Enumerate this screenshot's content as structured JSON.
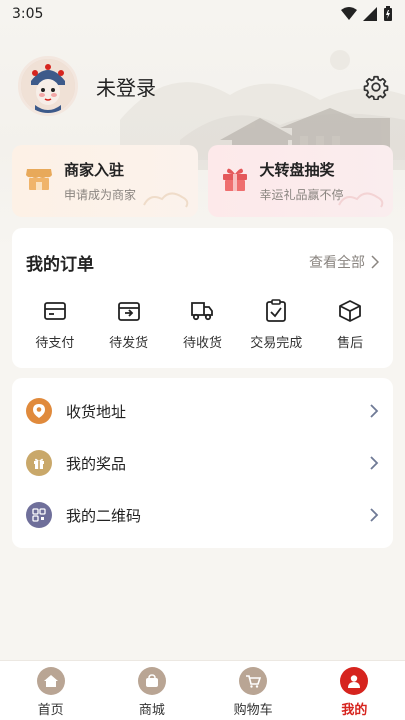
{
  "status": {
    "time": "3:05"
  },
  "profile": {
    "login_text": "未登录"
  },
  "promos": [
    {
      "title": "商家入驻",
      "subtitle": "申请成为商家"
    },
    {
      "title": "大转盘抽奖",
      "subtitle": "幸运礼品赢不停"
    }
  ],
  "orders": {
    "title": "我的订单",
    "view_all": "查看全部",
    "items": [
      {
        "label": "待支付"
      },
      {
        "label": "待发货"
      },
      {
        "label": "待收货"
      },
      {
        "label": "交易完成"
      },
      {
        "label": "售后"
      }
    ]
  },
  "menu": [
    {
      "label": "收货地址"
    },
    {
      "label": "我的奖品"
    },
    {
      "label": "我的二维码"
    }
  ],
  "tabs": [
    {
      "label": "首页"
    },
    {
      "label": "商城"
    },
    {
      "label": "购物车"
    },
    {
      "label": "我的"
    }
  ],
  "colors": {
    "accent": "#d6241e",
    "address_icon": "#e08a3c",
    "prize_icon": "#c9a86a",
    "qrcode_icon": "#6f6f9a"
  }
}
